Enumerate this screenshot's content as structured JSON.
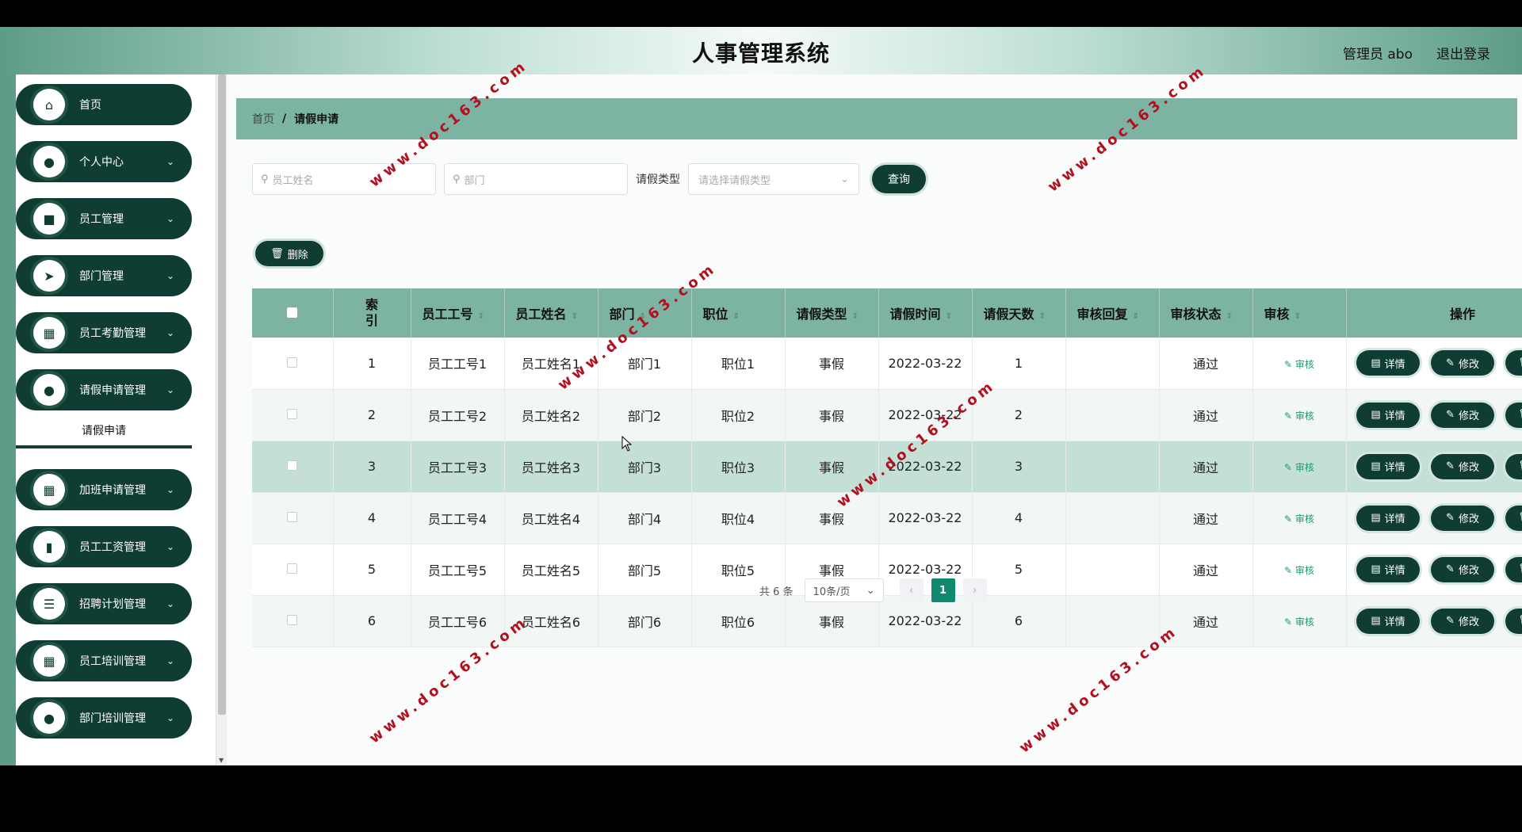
{
  "app": {
    "title": "人事管理系统",
    "admin": "管理员 abo",
    "logout": "退出登录"
  },
  "sidebar": {
    "items": [
      {
        "label": "首页",
        "icon": "home-icon",
        "glyph": "⌂"
      },
      {
        "label": "个人中心",
        "icon": "user-icon",
        "glyph": "●"
      },
      {
        "label": "员工管理",
        "icon": "briefcase-icon",
        "glyph": "■"
      },
      {
        "label": "部门管理",
        "icon": "send-icon",
        "glyph": "➤"
      },
      {
        "label": "员工考勤管理",
        "icon": "grid-icon",
        "glyph": "▦"
      },
      {
        "label": "请假申请管理",
        "icon": "user-icon",
        "glyph": "●"
      },
      {
        "label": "加班申请管理",
        "icon": "grid-icon",
        "glyph": "▦"
      },
      {
        "label": "员工工资管理",
        "icon": "bar-chart-icon",
        "glyph": "▮"
      },
      {
        "label": "招聘计划管理",
        "icon": "list-icon",
        "glyph": "☰"
      },
      {
        "label": "员工培训管理",
        "icon": "grid-icon",
        "glyph": "▦"
      },
      {
        "label": "部门培训管理",
        "icon": "user-icon",
        "glyph": "●"
      }
    ],
    "submenu_active": "请假申请"
  },
  "breadcrumb": {
    "home": "首页",
    "sep": "/",
    "current": "请假申请"
  },
  "search": {
    "name_placeholder": "员工姓名",
    "dept_placeholder": "部门",
    "type_label": "请假类型",
    "type_placeholder": "请选择请假类型",
    "query_button": "查询"
  },
  "bulk_delete": "删除",
  "table": {
    "headers": [
      "索引",
      "员工工号",
      "员工姓名",
      "部门",
      "职位",
      "请假类型",
      "请假时间",
      "请假天数",
      "审核回复",
      "审核状态",
      "审核",
      "操作"
    ],
    "audit_label": "审核",
    "ops": {
      "detail": "详情",
      "edit": "修改",
      "delete": "删除"
    },
    "rows": [
      [
        "1",
        "员工工号1",
        "员工姓名1",
        "部门1",
        "职位1",
        "事假",
        "2022-03-22",
        "1",
        "",
        "通过"
      ],
      [
        "2",
        "员工工号2",
        "员工姓名2",
        "部门2",
        "职位2",
        "事假",
        "2022-03-22",
        "2",
        "",
        "通过"
      ],
      [
        "3",
        "员工工号3",
        "员工姓名3",
        "部门3",
        "职位3",
        "事假",
        "2022-03-22",
        "3",
        "",
        "通过"
      ],
      [
        "4",
        "员工工号4",
        "员工姓名4",
        "部门4",
        "职位4",
        "事假",
        "2022-03-22",
        "4",
        "",
        "通过"
      ],
      [
        "5",
        "员工工号5",
        "员工姓名5",
        "部门5",
        "职位5",
        "事假",
        "2022-03-22",
        "5",
        "",
        "通过"
      ],
      [
        "6",
        "员工工号6",
        "员工姓名6",
        "部门6",
        "职位6",
        "事假",
        "2022-03-22",
        "6",
        "",
        "通过"
      ]
    ]
  },
  "pager": {
    "total": "共 6 条",
    "page_size": "10条/页",
    "current": "1"
  },
  "watermark": "www.doc163.com",
  "colors": {
    "brand_dark": "#103d33",
    "brand_mid": "#7cb3a3",
    "accent": "#108a6e",
    "watermark": "#b3101f"
  }
}
